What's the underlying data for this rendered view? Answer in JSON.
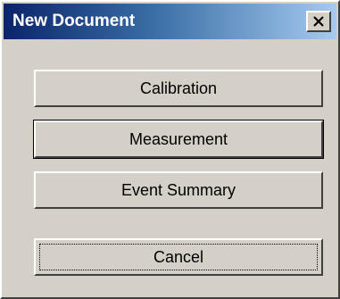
{
  "window": {
    "title": "New Document",
    "close_icon": "close-icon"
  },
  "buttons": {
    "calibration": "Calibration",
    "measurement": "Measurement",
    "event_summary": "Event Summary",
    "cancel": "Cancel"
  },
  "colors": {
    "titlebar_start": "#0a246a",
    "titlebar_end": "#a6caf0",
    "face": "#d4d0c8"
  }
}
